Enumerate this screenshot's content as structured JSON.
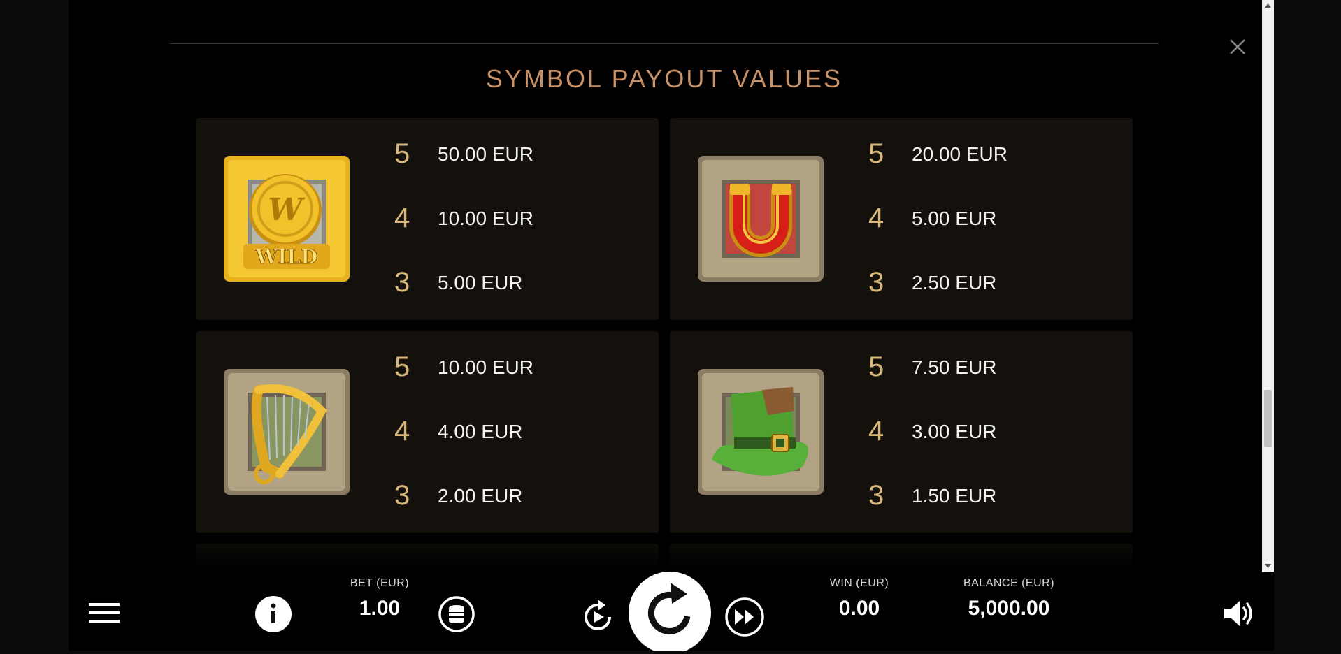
{
  "paytable": {
    "title": "SYMBOL PAYOUT VALUES",
    "symbols": [
      {
        "icon": "wild-coin-icon",
        "wild_text": "WILD",
        "pays": [
          {
            "count": "5",
            "value": "50.00 EUR"
          },
          {
            "count": "4",
            "value": "10.00 EUR"
          },
          {
            "count": "3",
            "value": "5.00 EUR"
          }
        ]
      },
      {
        "icon": "horseshoe-icon",
        "pays": [
          {
            "count": "5",
            "value": "20.00 EUR"
          },
          {
            "count": "4",
            "value": "5.00 EUR"
          },
          {
            "count": "3",
            "value": "2.50 EUR"
          }
        ]
      },
      {
        "icon": "harp-icon",
        "pays": [
          {
            "count": "5",
            "value": "10.00 EUR"
          },
          {
            "count": "4",
            "value": "4.00 EUR"
          },
          {
            "count": "3",
            "value": "2.00 EUR"
          }
        ]
      },
      {
        "icon": "green-hat-icon",
        "pays": [
          {
            "count": "5",
            "value": "7.50 EUR"
          },
          {
            "count": "4",
            "value": "3.00 EUR"
          },
          {
            "count": "3",
            "value": "1.50 EUR"
          }
        ]
      }
    ]
  },
  "controls": {
    "bet_label": "BET (EUR)",
    "bet_value": "1.00",
    "win_label": "WIN (EUR)",
    "win_value": "0.00",
    "balance_label": "BALANCE (EUR)",
    "balance_value": "5,000.00"
  },
  "colors": {
    "title": "#c79066",
    "count": "#d8b77a",
    "card_bg": "#14110c"
  }
}
